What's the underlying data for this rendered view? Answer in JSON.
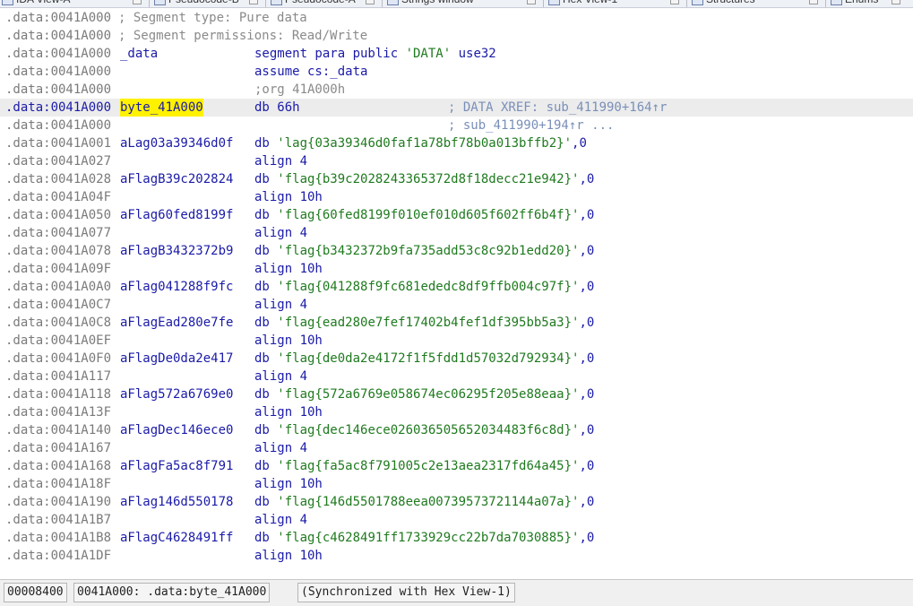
{
  "tabs": [
    {
      "label": "IDA View-A"
    },
    {
      "label": "Pseudocode-B"
    },
    {
      "label": "Pseudocode-A"
    },
    {
      "label": "Strings window"
    },
    {
      "label": "Hex View-1"
    },
    {
      "label": "Structures"
    },
    {
      "label": "Enums"
    }
  ],
  "rows": [
    {
      "addr": ".data:0041A000",
      "label": "",
      "op": "; Segment type: Pure data",
      "operand": "",
      "comment": ""
    },
    {
      "addr": ".data:0041A000",
      "label": "",
      "op": "; Segment permissions: Read/Write",
      "operand": "",
      "comment": ""
    },
    {
      "addr": ".data:0041A000",
      "label": "_data",
      "op": "segment para public 'DATA' use32",
      "operand": "",
      "comment": ""
    },
    {
      "addr": ".data:0041A000",
      "label": "",
      "op": "assume cs:_data",
      "operand": "",
      "comment": ""
    },
    {
      "addr": ".data:0041A000",
      "label": "",
      "op": ";org 41A000h",
      "operand": "",
      "comment": ""
    },
    {
      "addr": ".data:0041A000",
      "label": "byte_41A000",
      "op": "db 66h",
      "operand": "",
      "comment": "; DATA XREF: sub_411990+164↑r"
    },
    {
      "addr": ".data:0041A000",
      "label": "",
      "op": "",
      "operand": "",
      "comment": "; sub_411990+194↑r ..."
    },
    {
      "addr": ".data:0041A001",
      "label": "aLag03a39346d0f",
      "op": "db",
      "operand": "'lag{03a39346d0faf1a78bf78b0a013bffb2}'",
      "comment": ""
    },
    {
      "addr": ".data:0041A027",
      "label": "",
      "op": "align 4",
      "operand": "",
      "comment": ""
    },
    {
      "addr": ".data:0041A028",
      "label": "aFlagB39c202824",
      "op": "db",
      "operand": "'flag{b39c2028243365372d8f18decc21e942}'",
      "comment": ""
    },
    {
      "addr": ".data:0041A04F",
      "label": "",
      "op": "align 10h",
      "operand": "",
      "comment": ""
    },
    {
      "addr": ".data:0041A050",
      "label": "aFlag60fed8199f",
      "op": "db",
      "operand": "'flag{60fed8199f010ef010d605f602ff6b4f}'",
      "comment": ""
    },
    {
      "addr": ".data:0041A077",
      "label": "",
      "op": "align 4",
      "operand": "",
      "comment": ""
    },
    {
      "addr": ".data:0041A078",
      "label": "aFlagB3432372b9",
      "op": "db",
      "operand": "'flag{b3432372b9fa735add53c8c92b1edd20}'",
      "comment": ""
    },
    {
      "addr": ".data:0041A09F",
      "label": "",
      "op": "align 10h",
      "operand": "",
      "comment": ""
    },
    {
      "addr": ".data:0041A0A0",
      "label": "aFlag041288f9fc",
      "op": "db",
      "operand": "'flag{041288f9fc681ededc8df9ffb004c97f}'",
      "comment": ""
    },
    {
      "addr": ".data:0041A0C7",
      "label": "",
      "op": "align 4",
      "operand": "",
      "comment": ""
    },
    {
      "addr": ".data:0041A0C8",
      "label": "aFlagEad280e7fe",
      "op": "db",
      "operand": "'flag{ead280e7fef17402b4fef1df395bb5a3}'",
      "comment": ""
    },
    {
      "addr": ".data:0041A0EF",
      "label": "",
      "op": "align 10h",
      "operand": "",
      "comment": ""
    },
    {
      "addr": ".data:0041A0F0",
      "label": "aFlagDe0da2e417",
      "op": "db",
      "operand": "'flag{de0da2e4172f1f5fdd1d57032d792934}'",
      "comment": ""
    },
    {
      "addr": ".data:0041A117",
      "label": "",
      "op": "align 4",
      "operand": "",
      "comment": ""
    },
    {
      "addr": ".data:0041A118",
      "label": "aFlag572a6769e0",
      "op": "db",
      "operand": "'flag{572a6769e058674ec06295f205e88eaa}'",
      "comment": ""
    },
    {
      "addr": ".data:0041A13F",
      "label": "",
      "op": "align 10h",
      "operand": "",
      "comment": ""
    },
    {
      "addr": ".data:0041A140",
      "label": "aFlagDec146ece0",
      "op": "db",
      "operand": "'flag{dec146ece02603650565203448 3f6c8d}'",
      "comment": ""
    },
    {
      "addr": ".data:0041A167",
      "label": "",
      "op": "align 4",
      "operand": "",
      "comment": ""
    },
    {
      "addr": ".data:0041A168",
      "label": "aFlagFa5ac8f791",
      "op": "db",
      "operand": "'flag{fa5ac8f791005c2e13aea2317fd64a45}'",
      "comment": ""
    },
    {
      "addr": ".data:0041A18F",
      "label": "",
      "op": "align 10h",
      "operand": "",
      "comment": ""
    },
    {
      "addr": ".data:0041A190",
      "label": "aFlag146d550178",
      "op": "db",
      "operand": "'flag{146d5501788eea00739573721144a07a}'",
      "comment": ""
    },
    {
      "addr": ".data:0041A1B7",
      "label": "",
      "op": "align 4",
      "operand": "",
      "comment": ""
    },
    {
      "addr": ".data:0041A1B8",
      "label": "aFlagC4628491ff",
      "op": "db",
      "operand": "'flag{c4628491ff1733929cc22b7da7030885}'",
      "comment": ""
    },
    {
      "addr": ".data:0041A1DF",
      "label": "",
      "op": "align 10h",
      "operand": "",
      "comment": ""
    }
  ],
  "terminator": ",0",
  "highlight_row": 5,
  "status": {
    "offset": "00008400",
    "location": "0041A000: .data:byte_41A000",
    "sync": "(Synchronized with Hex View-1)"
  },
  "colors": {
    "accent_blue": "#1a1aa8",
    "string_green": "#1f7a1f",
    "highlight_yellow": "#fff200",
    "comment_gray": "#8a8a8a"
  }
}
